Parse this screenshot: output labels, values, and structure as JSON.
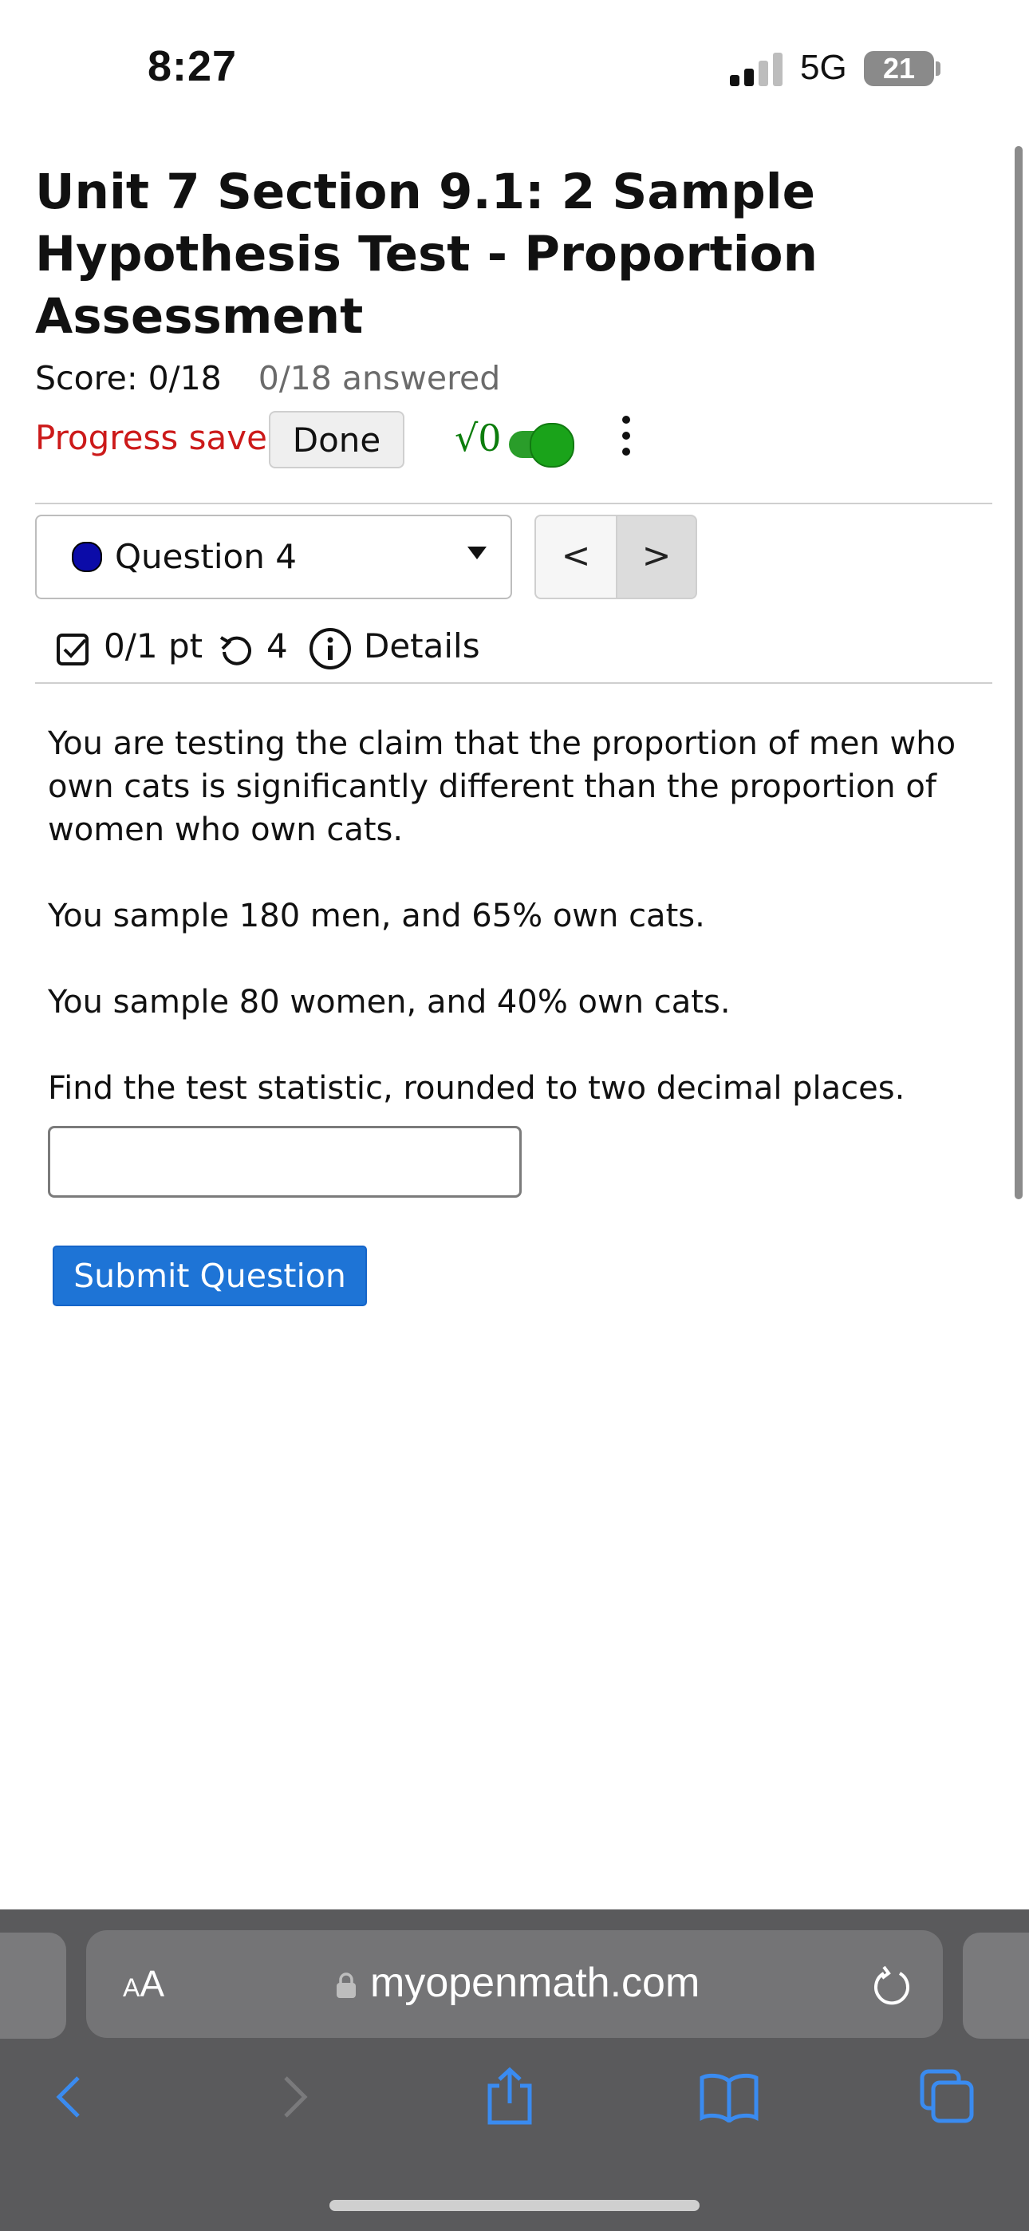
{
  "status_bar": {
    "time": "8:27",
    "network": "5G",
    "battery": "21"
  },
  "assessment": {
    "title": "Unit 7 Section 9.1: 2 Sample Hypothesis Test - Proportion Assessment",
    "score": "Score: 0/18",
    "answered": "0/18 answered",
    "progress_saved": "Progress saved",
    "done_label": "Done",
    "math_symbol": "√0"
  },
  "question_nav": {
    "selected": "Question 4",
    "prev_symbol": "<",
    "next_symbol": ">"
  },
  "question_info": {
    "points": "0/1 pt",
    "retries": "4",
    "details_label": "Details"
  },
  "question": {
    "paragraphs": [
      "You are testing the claim that the proportion of men who own cats is significantly different than the proportion of women who own cats.",
      "You sample 180 men, and 65% own cats.",
      "You sample 80 women, and 40% own cats.",
      "Find the test statistic, rounded to two decimal places."
    ],
    "answer_value": "",
    "submit_label": "Submit Question"
  },
  "browser": {
    "aa_label_small": "A",
    "aa_label_large": "A",
    "url": "myopenmath.com"
  },
  "colors": {
    "accent": "#1e74d6",
    "error": "#cc1a1a",
    "toggle_on": "#1aa31a"
  },
  "icons": [
    "signal-icon",
    "battery-icon",
    "math-entry-icon",
    "toggle-switch",
    "kebab-menu-icon",
    "question-status-dot",
    "dropdown-caret-icon",
    "chevron-left-icon",
    "chevron-right-icon",
    "checkbox-icon",
    "retry-icon",
    "info-icon",
    "lock-icon",
    "reload-icon",
    "back-icon",
    "forward-icon",
    "share-icon",
    "bookmarks-icon",
    "tabs-icon"
  ]
}
